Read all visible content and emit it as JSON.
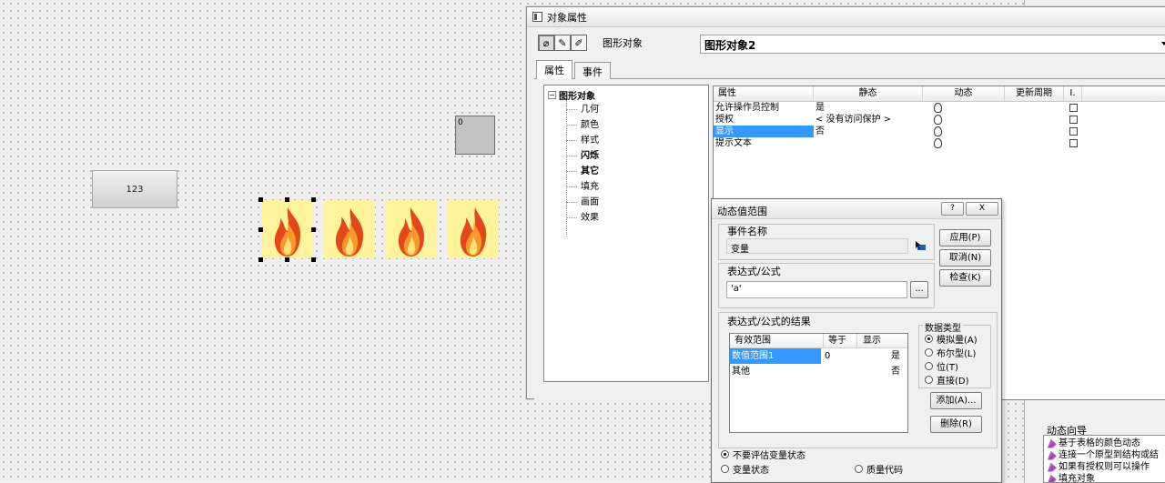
{
  "canvas": {
    "io_field_value": "123",
    "small_box_value": "0"
  },
  "top_right": {
    "help_label": "?"
  },
  "wizard": {
    "title": "动态向导",
    "items": [
      "基于表格的颜色动态",
      "连接一个原型到结构或结",
      "如果有授权则可以操作",
      "填充对象"
    ]
  },
  "props": {
    "title": "对象属性",
    "object_type": "图形对象",
    "object_name": "图形对象2",
    "tabs": [
      "属性",
      "事件"
    ],
    "tree_root": "图形对象",
    "tree_items": [
      "几何",
      "颜色",
      "样式",
      "闪烁",
      "其它",
      "填充",
      "画面",
      "效果"
    ],
    "columns": [
      "属性",
      "静态",
      "动态",
      "更新周期",
      "I."
    ],
    "rows": [
      {
        "name": "允许操作员控制",
        "static": "是"
      },
      {
        "name": "授权",
        "static": "< 没有访问保护 >"
      },
      {
        "name": "显示",
        "static": "否"
      },
      {
        "name": "提示文本",
        "static": ""
      }
    ]
  },
  "dialog": {
    "title": "动态值范围",
    "help": "?",
    "close": "X",
    "event_name_label": "事件名称",
    "event_name_value": "变量",
    "expr_label": "表达式/公式",
    "expr_value": "'a'",
    "browse_label": "...",
    "result_label": "表达式/公式的结果",
    "result_columns": [
      "有效范围",
      "等于",
      "显示"
    ],
    "result_rows": [
      {
        "range": "数值范围1",
        "equals": "0",
        "show": "是"
      },
      {
        "range": "其他",
        "equals": "",
        "show": "否"
      }
    ],
    "datatype_label": "数据类型",
    "datatypes": [
      "模拟量(A)",
      "布尔型(L)",
      "位(T)",
      "直接(D)"
    ],
    "buttons": {
      "apply": "应用(P)",
      "cancel": "取消(N)",
      "check": "检查(K)",
      "add": "添加(A)...",
      "delete": "删除(R)"
    },
    "bottom_options": [
      "不要评估变量状态",
      "变量状态",
      "质量代码"
    ]
  }
}
